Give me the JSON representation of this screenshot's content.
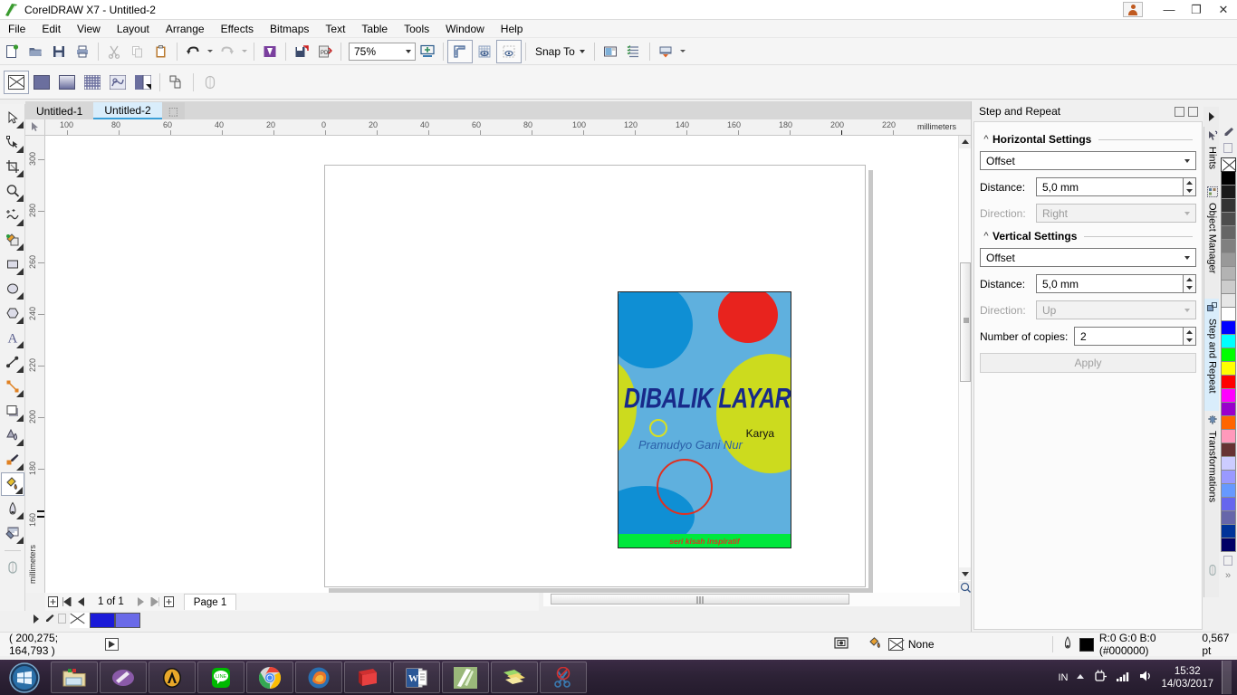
{
  "window": {
    "app_title": "CorelDRAW X7 - Untitled-2",
    "logo_icon": "coreldraw-balloon-icon",
    "avatar_icon": "user-account-icon",
    "minimize_label": "—",
    "restore_label": "❐",
    "close_label": "✕"
  },
  "menubar": {
    "items": [
      {
        "label": "File",
        "accel": "F"
      },
      {
        "label": "Edit",
        "accel": "E"
      },
      {
        "label": "View",
        "accel": "V"
      },
      {
        "label": "Layout",
        "accel": "L"
      },
      {
        "label": "Arrange",
        "accel": "A"
      },
      {
        "label": "Effects",
        "accel": "c"
      },
      {
        "label": "Bitmaps",
        "accel": "B"
      },
      {
        "label": "Text",
        "accel": "x"
      },
      {
        "label": "Table",
        "accel": "T"
      },
      {
        "label": "Tools",
        "accel": "o"
      },
      {
        "label": "Window",
        "accel": "W"
      },
      {
        "label": "Help",
        "accel": "H"
      }
    ]
  },
  "toolbar": {
    "buttons": [
      {
        "name": "new-document-icon",
        "title": "New"
      },
      {
        "name": "open-document-icon",
        "title": "Open"
      },
      {
        "name": "save-document-icon",
        "title": "Save"
      },
      {
        "name": "print-icon",
        "title": "Print"
      },
      {
        "name": "cut-icon",
        "title": "Cut"
      },
      {
        "name": "copy-icon",
        "title": "Copy"
      },
      {
        "name": "paste-icon",
        "title": "Paste"
      },
      {
        "name": "undo-icon",
        "title": "Undo"
      },
      {
        "name": "redo-icon",
        "title": "Redo"
      },
      {
        "name": "import-icon",
        "title": "Import"
      },
      {
        "name": "export-icon",
        "title": "Export"
      },
      {
        "name": "publish-pdf-icon",
        "title": "Publish to PDF"
      }
    ],
    "zoom_value": "75%",
    "zoom_to_fit_icon": "zoom-to-fit-icon",
    "show_rulers_icon": "show-rulers-icon",
    "show_grid_icon": "show-grid-icon",
    "show_guides_icon": "show-guides-icon",
    "snap_to_label": "Snap To",
    "options_icon": "options-icon",
    "object-styles_icon": "object-styles-icon",
    "application-launcher_icon": "application-launcher-icon"
  },
  "propertybar": {
    "fill_buttons": [
      {
        "name": "no-fill-icon",
        "selected": true
      },
      {
        "name": "uniform-fill-icon",
        "selected": false
      },
      {
        "name": "fountain-fill-icon",
        "selected": false
      },
      {
        "name": "pattern-fill-icon",
        "selected": false
      },
      {
        "name": "texture-fill-icon",
        "selected": false
      },
      {
        "name": "postscript-fill-icon",
        "selected": false
      },
      {
        "name": "copy-fill-properties-icon",
        "selected": false
      },
      {
        "name": "edit-fill-icon",
        "selected": false
      }
    ]
  },
  "doc_tabs": {
    "items": [
      {
        "label": "Untitled-1",
        "active": false
      },
      {
        "label": "Untitled-2",
        "active": true
      }
    ],
    "new_tab_label": "⬚"
  },
  "toolbox": {
    "tools": [
      {
        "name": "pick-tool-icon",
        "label": "Pick Tool",
        "selected": false
      },
      {
        "name": "shape-tool-icon",
        "label": "Shape Tool",
        "selected": false
      },
      {
        "name": "crop-tool-icon",
        "label": "Crop Tool",
        "selected": false
      },
      {
        "name": "zoom-tool-icon",
        "label": "Zoom Tool",
        "selected": false
      },
      {
        "name": "freehand-tool-icon",
        "label": "Freehand Tool",
        "selected": false
      },
      {
        "name": "smart-fill-tool-icon",
        "label": "Smart Fill Tool",
        "selected": false
      },
      {
        "name": "rectangle-tool-icon",
        "label": "Rectangle Tool",
        "selected": false
      },
      {
        "name": "ellipse-tool-icon",
        "label": "Ellipse Tool",
        "selected": false
      },
      {
        "name": "polygon-tool-icon",
        "label": "Polygon Tool",
        "selected": false
      },
      {
        "name": "text-tool-icon",
        "label": "Text Tool",
        "selected": false
      },
      {
        "name": "parallel-dimension-tool-icon",
        "label": "Parallel Dimension Tool",
        "selected": false
      },
      {
        "name": "straight-line-connector-tool-icon",
        "label": "Straight-Line Connector Tool",
        "selected": false
      },
      {
        "name": "drop-shadow-tool-icon",
        "label": "Drop Shadow Tool",
        "selected": false
      },
      {
        "name": "transparency-tool-icon",
        "label": "Transparency Tool",
        "selected": false
      },
      {
        "name": "color-eyedropper-tool-icon",
        "label": "Color Eyedropper Tool",
        "selected": false
      },
      {
        "name": "fill-tool-icon",
        "label": "Fill Tool",
        "selected": true
      },
      {
        "name": "outline-tool-icon",
        "label": "Outline Tool",
        "selected": false
      },
      {
        "name": "interactive-fill-tool-icon",
        "label": "Interactive Fill Tool",
        "selected": false
      },
      {
        "name": "quick-preview-tool-icon",
        "label": "Quick Preview",
        "selected": false
      }
    ]
  },
  "rulers": {
    "unit_label": "millimeters",
    "horizontal_ticks": [
      "100",
      "80",
      "60",
      "40",
      "20",
      "0",
      "20",
      "40",
      "60",
      "80",
      "100",
      "120",
      "140",
      "160",
      "180",
      "200",
      "220"
    ],
    "vertical_ticks": [
      "300",
      "280",
      "260",
      "240",
      "220",
      "200",
      "180",
      "160"
    ]
  },
  "artwork": {
    "title_text": "DIBALIK LAYAR",
    "byline_label": "Karya",
    "author": "Pramudyo Gani Nur",
    "band_text": "seri kisah inspiratif",
    "colors": {
      "background": "#5fb0de",
      "blue_circle": "#0f8fd4",
      "red_circle": "#e8231e",
      "yellow_circle": "#ccdb1e",
      "band_green": "#00e83c",
      "band_text": "#e03020",
      "title_navy": "#182a8a",
      "author_blue": "#2a5fa8",
      "red_ring": "#e03020",
      "yellow_ring": "#d8e022"
    }
  },
  "pagebar": {
    "first_icon": "first-page-icon",
    "prev_icon": "previous-page-icon",
    "next_icon": "next-page-icon",
    "last_icon": "last-page-icon",
    "add_page_before_icon": "add-page-before-icon",
    "add_page_after_icon": "add-page-after-icon",
    "page_count_label": "1 of 1",
    "page_tab_label": "Page 1"
  },
  "statusbar": {
    "coordinates": "( 200,275; 164,793 )",
    "play_icon": "play-macro-icon",
    "screen_icon": "screen-capture-icon",
    "fill_icon": "fill-color-icon",
    "fill_value": "None",
    "outline_icon": "outline-pen-icon",
    "outline_swatch": "#000000",
    "outline_value": "R:0 G:0 B:0 (#000000)",
    "outline_width": "0,567 pt"
  },
  "docker": {
    "title": "Step and Repeat",
    "pin_icon": "pin-icon",
    "close_icon": "close-docker-icon",
    "horizontal": {
      "group_label": "Horizontal Settings",
      "mode_value": "Offset",
      "distance_label": "Distance:",
      "distance_value": "5,0 mm",
      "direction_label": "Direction:",
      "direction_value": "Right"
    },
    "vertical": {
      "group_label": "Vertical Settings",
      "mode_value": "Offset",
      "distance_label": "Distance:",
      "distance_value": "5,0 mm",
      "direction_label": "Direction:",
      "direction_value": "Up"
    },
    "copies_label": "Number of copies:",
    "copies_value": "2",
    "apply_label": "Apply",
    "side_tabs": [
      {
        "label": "Hints",
        "icon": "hints-icon",
        "active": false
      },
      {
        "label": "Object Manager",
        "icon": "object-manager-icon",
        "active": false
      },
      {
        "label": "Step and Repeat",
        "icon": "step-and-repeat-icon",
        "active": true
      },
      {
        "label": "Transformations",
        "icon": "transformations-icon",
        "active": false
      }
    ]
  },
  "palette": {
    "eyedropper_icon": "palette-eyedropper-icon",
    "none_label": "No Color",
    "swatches": [
      "#000000",
      "#1a1a1a",
      "#333333",
      "#4d4d4d",
      "#666666",
      "#808080",
      "#999999",
      "#b3b3b3",
      "#cccccc",
      "#e6e6e6",
      "#ffffff",
      "#0000ff",
      "#00ffff",
      "#00ff00",
      "#ffff00",
      "#ff0000",
      "#ff00ff",
      "#9900cc",
      "#ff6600",
      "#ff99bb",
      "#663333",
      "#ccccff",
      "#9999ff",
      "#6699ff",
      "#6666ee",
      "#6666aa",
      "#003399",
      "#000066"
    ]
  },
  "taskbar": {
    "start_label": "Start",
    "apps": [
      {
        "name": "file-explorer-icon",
        "label": "File Explorer"
      },
      {
        "name": "paint-app-icon",
        "label": "Paint"
      },
      {
        "name": "autodesk-app-icon",
        "label": "Autodesk"
      },
      {
        "name": "line-app-icon",
        "label": "LINE"
      },
      {
        "name": "chrome-app-icon",
        "label": "Google Chrome"
      },
      {
        "name": "firefox-app-icon",
        "label": "Mozilla Firefox"
      },
      {
        "name": "ebook-app-icon",
        "label": "E-Book Reader"
      },
      {
        "name": "word-app-icon",
        "label": "Microsoft Word"
      },
      {
        "name": "coreldraw-app-icon",
        "label": "CorelDRAW X7"
      },
      {
        "name": "folders-app-icon",
        "label": "Folders"
      },
      {
        "name": "snipping-tool-icon",
        "label": "Snipping Tool"
      }
    ],
    "tray": {
      "language": "IN",
      "show_hidden_icon": "show-hidden-icons-icon",
      "power_icon": "power-plug-icon",
      "network_icon": "network-signal-icon",
      "volume_icon": "volume-icon",
      "time": "15:32",
      "date": "14/03/2017"
    }
  }
}
